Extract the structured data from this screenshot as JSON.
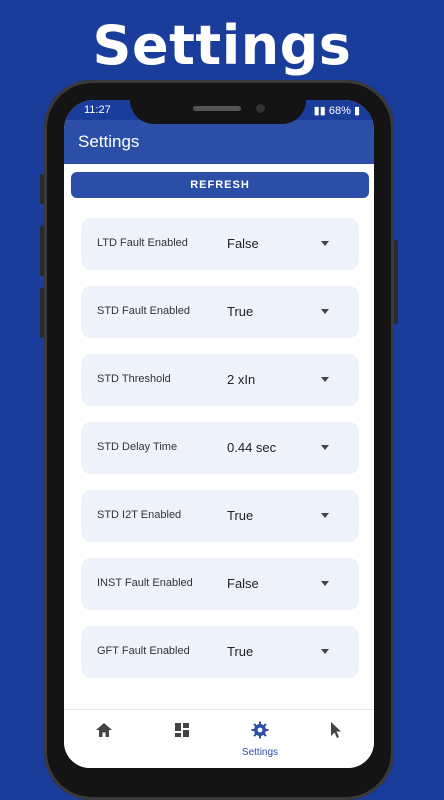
{
  "hero": {
    "title": "Settings"
  },
  "status": {
    "time": "11:27",
    "right": "68%"
  },
  "appbar": {
    "title": "Settings"
  },
  "refresh": {
    "label": "REFRESH"
  },
  "settings": [
    {
      "label": "LTD Fault Enabled",
      "value": "False"
    },
    {
      "label": "STD Fault Enabled",
      "value": "True"
    },
    {
      "label": "STD Threshold",
      "value": "2 xIn"
    },
    {
      "label": "STD Delay Time",
      "value": "0.44 sec"
    },
    {
      "label": "STD I2T Enabled",
      "value": "True"
    },
    {
      "label": "INST Fault Enabled",
      "value": "False"
    },
    {
      "label": "GFT Fault Enabled",
      "value": "True"
    }
  ],
  "nav": {
    "settings_label": "Settings",
    "icons": [
      "home-icon",
      "dashboard-icon",
      "gear-icon",
      "cursor-icon"
    ]
  },
  "colors": {
    "background": "#1a3c9a",
    "accent": "#2b4fa6",
    "row_bg": "#eef2fb"
  }
}
